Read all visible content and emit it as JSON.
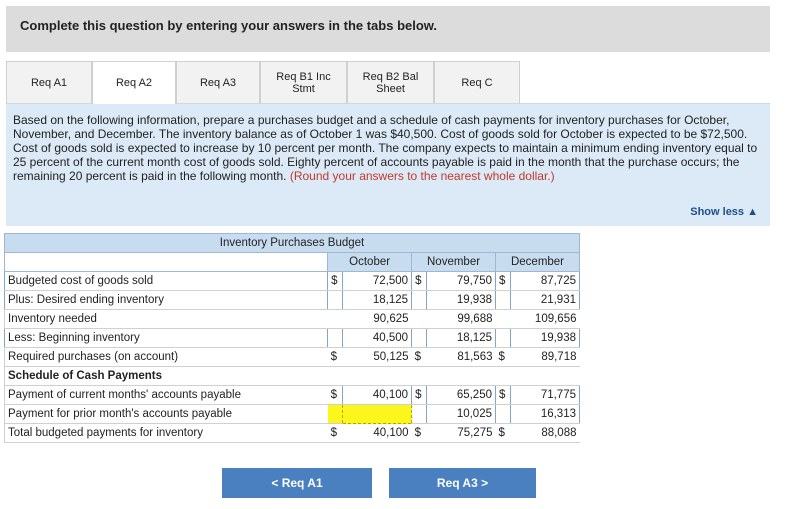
{
  "header": {
    "title": "Complete this question by entering your answers in the tabs below."
  },
  "tabs": [
    {
      "label": "Req A1"
    },
    {
      "label": "Req A2"
    },
    {
      "label": "Req A3"
    },
    {
      "label": "Req B1 Inc Stmt"
    },
    {
      "label": "Req B2 Bal Sheet"
    },
    {
      "label": "Req C"
    }
  ],
  "instructions": {
    "text": "Based on the following information, prepare a purchases budget and a schedule of cash payments for inventory purchases for October, November, and December. The inventory balance as of October 1 was $40,500. Cost of goods sold for October is expected to be $72,500. Cost of goods sold is expected to increase by 10 percent per month. The company expects to maintain a minimum ending inventory equal to 25 percent of the current month cost of goods sold. Eighty percent of accounts payable is paid in the month that the purchase occurs; the remaining 20 percent is paid in the following month. ",
    "note": "(Round your answers to the nearest whole dollar.)",
    "show_less": "Show less ▲"
  },
  "table": {
    "title": "Inventory Purchases Budget",
    "columns": [
      "October",
      "November",
      "December"
    ],
    "rows": [
      {
        "label": "Budgeted cost of goods sold",
        "cells": [
          [
            "$",
            "72,500"
          ],
          [
            "$",
            "79,750"
          ],
          [
            "$",
            "87,725"
          ]
        ]
      },
      {
        "label": "Plus: Desired ending inventory",
        "cells": [
          [
            "",
            "18,125"
          ],
          [
            "",
            "19,938"
          ],
          [
            "",
            "21,931"
          ]
        ]
      },
      {
        "label": "Inventory needed",
        "cells": [
          [
            "",
            "90,625"
          ],
          [
            "",
            "99,688"
          ],
          [
            "",
            "109,656"
          ]
        ]
      },
      {
        "label": "Less: Beginning inventory",
        "cells": [
          [
            "",
            "40,500"
          ],
          [
            "",
            "18,125"
          ],
          [
            "",
            "19,938"
          ]
        ]
      },
      {
        "label": "Required purchases (on account)",
        "cells": [
          [
            "$",
            "50,125"
          ],
          [
            "$",
            "81,563"
          ],
          [
            "$",
            "89,718"
          ]
        ]
      },
      {
        "label": "Schedule of Cash Payments",
        "cells": []
      },
      {
        "label": "Payment of current months' accounts payable",
        "cells": [
          [
            "$",
            "40,100"
          ],
          [
            "$",
            "65,250"
          ],
          [
            "$",
            "71,775"
          ]
        ]
      },
      {
        "label": "Payment for prior month's accounts payable",
        "cells": [
          [
            "",
            ""
          ],
          [
            "",
            "10,025"
          ],
          [
            "",
            "16,313"
          ]
        ]
      },
      {
        "label": "Total budgeted payments for inventory",
        "cells": [
          [
            "$",
            "40,100"
          ],
          [
            "$",
            "75,275"
          ],
          [
            "$",
            "88,088"
          ]
        ]
      }
    ]
  },
  "nav": {
    "prev": "< Req A1",
    "next": "Req A3 >"
  }
}
